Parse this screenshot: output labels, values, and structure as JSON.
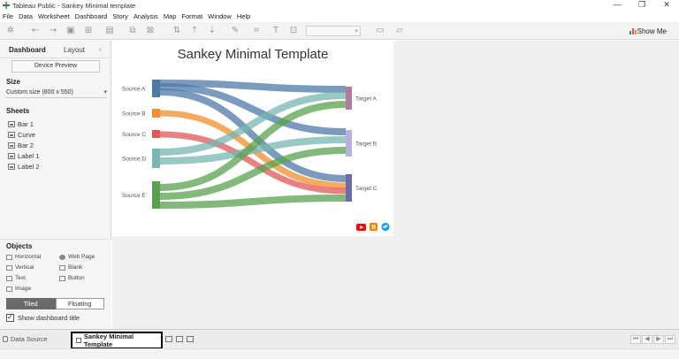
{
  "window": {
    "title": "Tableau Public - Sankey Minimal template",
    "minimize": "—",
    "restore": "❐",
    "close": "✕"
  },
  "menu": [
    "File",
    "Data",
    "Worksheet",
    "Dashboard",
    "Story",
    "Analysis",
    "Map",
    "Format",
    "Window",
    "Help"
  ],
  "toolbar": {
    "show_me_label": "Show Me"
  },
  "left_panel": {
    "tab_dashboard": "Dashboard",
    "tab_layout": "Layout",
    "collapse": "‹",
    "device_preview": "Device Preview",
    "size_title": "Size",
    "size_value": "Custom size (800 x 550)",
    "sheets_title": "Sheets",
    "sheets": [
      "Bar 1",
      "Curve",
      "Bar 2",
      "Label 1",
      "Label 2"
    ],
    "objects_title": "Objects",
    "objects": [
      "Horizontal",
      "Web Page",
      "Vertical",
      "Blank",
      "Text",
      "Button",
      "Image"
    ],
    "tiled": "Tiled",
    "floating": "Floating",
    "show_dashboard_title": "Show dashboard title"
  },
  "dashboard": {
    "title": "Sankey Minimal Template",
    "sources": [
      {
        "label": "Source A",
        "color": "#4e79a7"
      },
      {
        "label": "Source B",
        "color": "#f28e2b"
      },
      {
        "label": "Source C",
        "color": "#e15759"
      },
      {
        "label": "Source D",
        "color": "#76b7b2"
      },
      {
        "label": "Source E",
        "color": "#59a14f"
      }
    ],
    "targets": [
      {
        "label": "Target A",
        "color": "#b07aa1"
      },
      {
        "label": "Target B",
        "color": "#b8b0e0"
      },
      {
        "label": "Target C",
        "color": "#6b6ba8"
      }
    ],
    "social_colors": {
      "youtube": "#ff0000",
      "blogger": "#f57d00",
      "twitter": "#1da1f2"
    }
  },
  "bottom": {
    "data_source": "Data Source",
    "active_tab": "Sankey Minimal Template"
  }
}
